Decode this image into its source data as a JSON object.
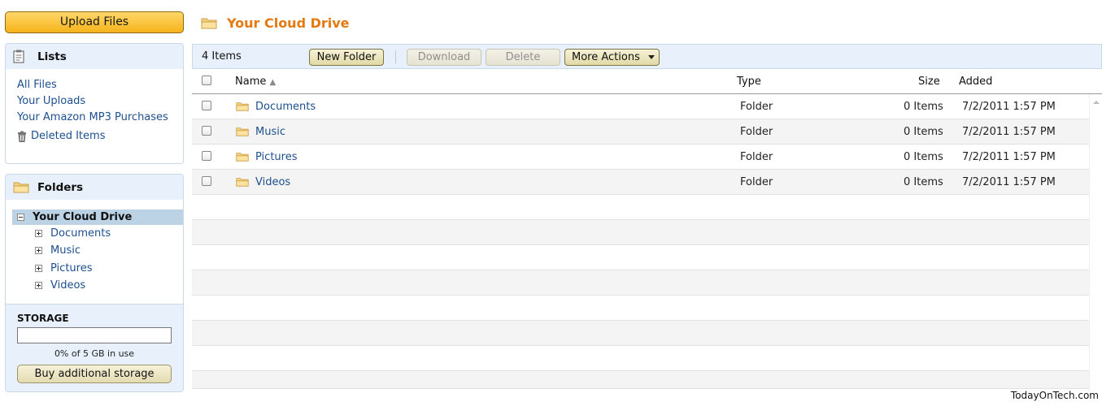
{
  "sidebar": {
    "upload_label": "Upload Files",
    "lists": {
      "title": "Lists",
      "items": [
        "All Files",
        "Your Uploads",
        "Your Amazon MP3 Purchases"
      ],
      "deleted": "Deleted Items"
    },
    "folders": {
      "title": "Folders",
      "root": "Your Cloud Drive",
      "items": [
        "Documents",
        "Music",
        "Pictures",
        "Videos"
      ]
    },
    "storage": {
      "title": "STORAGE",
      "usage_text": "0% of 5 GB in use",
      "used_fraction": 0,
      "buy_label": "Buy additional storage"
    }
  },
  "main": {
    "title": "Your Cloud Drive",
    "toolbar": {
      "count": "4 Items",
      "new_folder": "New Folder",
      "download": "Download",
      "delete": "Delete",
      "more_actions": "More Actions"
    },
    "columns": {
      "name": "Name",
      "type": "Type",
      "size": "Size",
      "added": "Added"
    },
    "rows": [
      {
        "name": "Documents",
        "type": "Folder",
        "size": "0 Items",
        "added": "7/2/2011 1:57 PM"
      },
      {
        "name": "Music",
        "type": "Folder",
        "size": "0 Items",
        "added": "7/2/2011 1:57 PM"
      },
      {
        "name": "Pictures",
        "type": "Folder",
        "size": "0 Items",
        "added": "7/2/2011 1:57 PM"
      },
      {
        "name": "Videos",
        "type": "Folder",
        "size": "0 Items",
        "added": "7/2/2011 1:57 PM"
      }
    ]
  },
  "watermark": "TodayOnTech.com",
  "colors": {
    "accent_orange": "#e4790f",
    "link_blue": "#1d4f8f",
    "panel_bg": "#e8f1fb",
    "tree_selected": "#bcd3e6"
  },
  "icons": [
    "folder-icon",
    "clipboard-icon",
    "trash-icon",
    "sort-ascending-icon",
    "dropdown-caret-icon"
  ]
}
